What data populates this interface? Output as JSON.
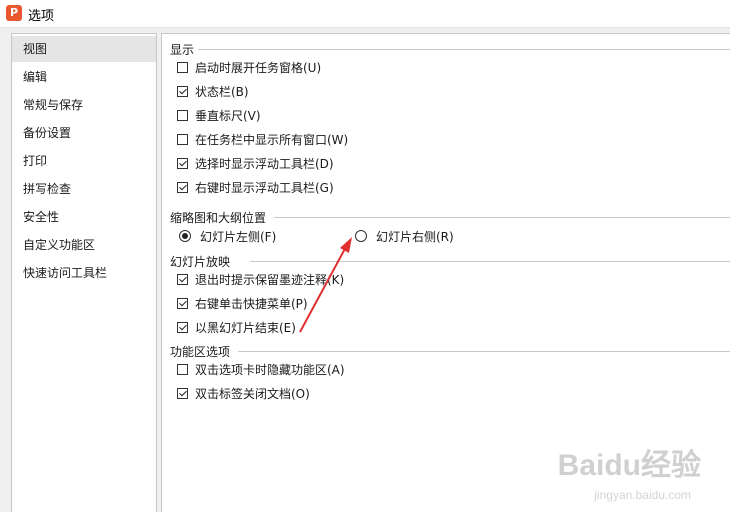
{
  "window": {
    "title": "选项",
    "app_icon_letter": "P",
    "app_icon_color": "#e8572e"
  },
  "sidebar": {
    "items": [
      {
        "label": "视图",
        "selected": true
      },
      {
        "label": "编辑"
      },
      {
        "label": "常规与保存"
      },
      {
        "label": "备份设置"
      },
      {
        "label": "打印"
      },
      {
        "label": "拼写检查"
      },
      {
        "label": "安全性"
      },
      {
        "label": "自定义功能区"
      },
      {
        "label": "快速访问工具栏"
      }
    ]
  },
  "sections": {
    "display": {
      "title": "显示",
      "options": [
        {
          "label": "启动时展开任务窗格(U)",
          "checked": false
        },
        {
          "label": "状态栏(B)",
          "checked": true
        },
        {
          "label": "垂直标尺(V)",
          "checked": false
        },
        {
          "label": "在任务栏中显示所有窗口(W)",
          "checked": false
        },
        {
          "label": "选择时显示浮动工具栏(D)",
          "checked": true
        },
        {
          "label": "右键时显示浮动工具栏(G)",
          "checked": true
        }
      ]
    },
    "thumbnail": {
      "title": "缩略图和大纲位置",
      "options": [
        {
          "label": "幻灯片左侧(F)",
          "selected": true
        },
        {
          "label": "幻灯片右侧(R)",
          "selected": false
        }
      ]
    },
    "slideshow": {
      "title": "幻灯片放映",
      "options": [
        {
          "label": "退出时提示保留墨迹注释(K)",
          "checked": true
        },
        {
          "label": "右键单击快捷菜单(P)",
          "checked": true
        },
        {
          "label": "以黑幻灯片结束(E)",
          "checked": true
        }
      ]
    },
    "ribbon": {
      "title": "功能区选项",
      "options": [
        {
          "label": "双击选项卡时隐藏功能区(A)",
          "checked": false
        },
        {
          "label": "双击标签关闭文档(O)",
          "checked": true
        }
      ]
    }
  },
  "watermark": {
    "text": "Baidu经验",
    "sub": "jingyan.baidu.com"
  },
  "annotation": {
    "arrow_color": "#e03030"
  }
}
